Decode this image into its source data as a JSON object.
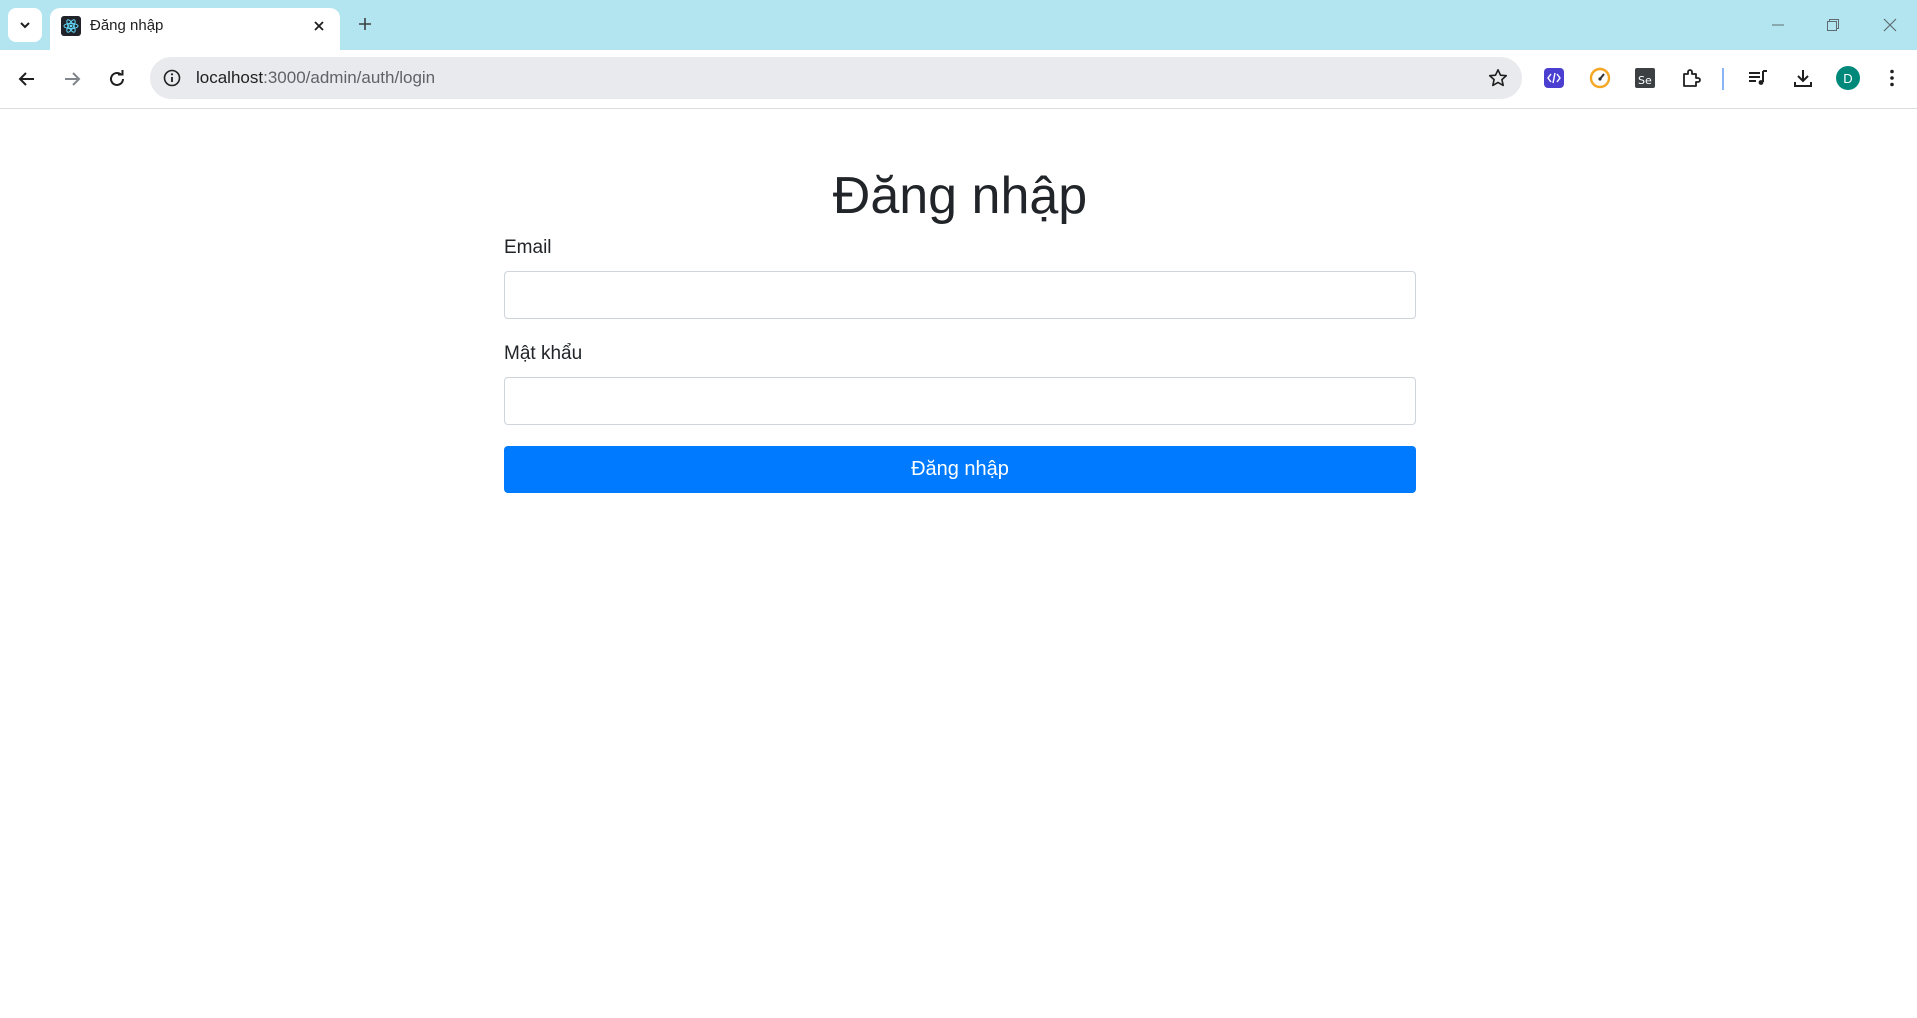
{
  "browser": {
    "tab": {
      "title": "Đăng nhập",
      "favicon": "react-logo-icon"
    },
    "address_bar": {
      "host": "localhost",
      "path": ":3000/admin/auth/login"
    },
    "profile": {
      "initial": "D",
      "color": "#00897b"
    },
    "theme": {
      "tabstrip_color": "#b3e5f0"
    },
    "extensions": [
      "code-extension-icon",
      "speedometer-extension-icon",
      "selenium-extension-icon",
      "puzzle-extensions-icon"
    ]
  },
  "login": {
    "title": "Đăng nhập",
    "email_label": "Email",
    "email_value": "",
    "password_label": "Mật khẩu",
    "password_value": "",
    "submit_label": "Đăng nhập",
    "submit_color": "#007bff"
  }
}
